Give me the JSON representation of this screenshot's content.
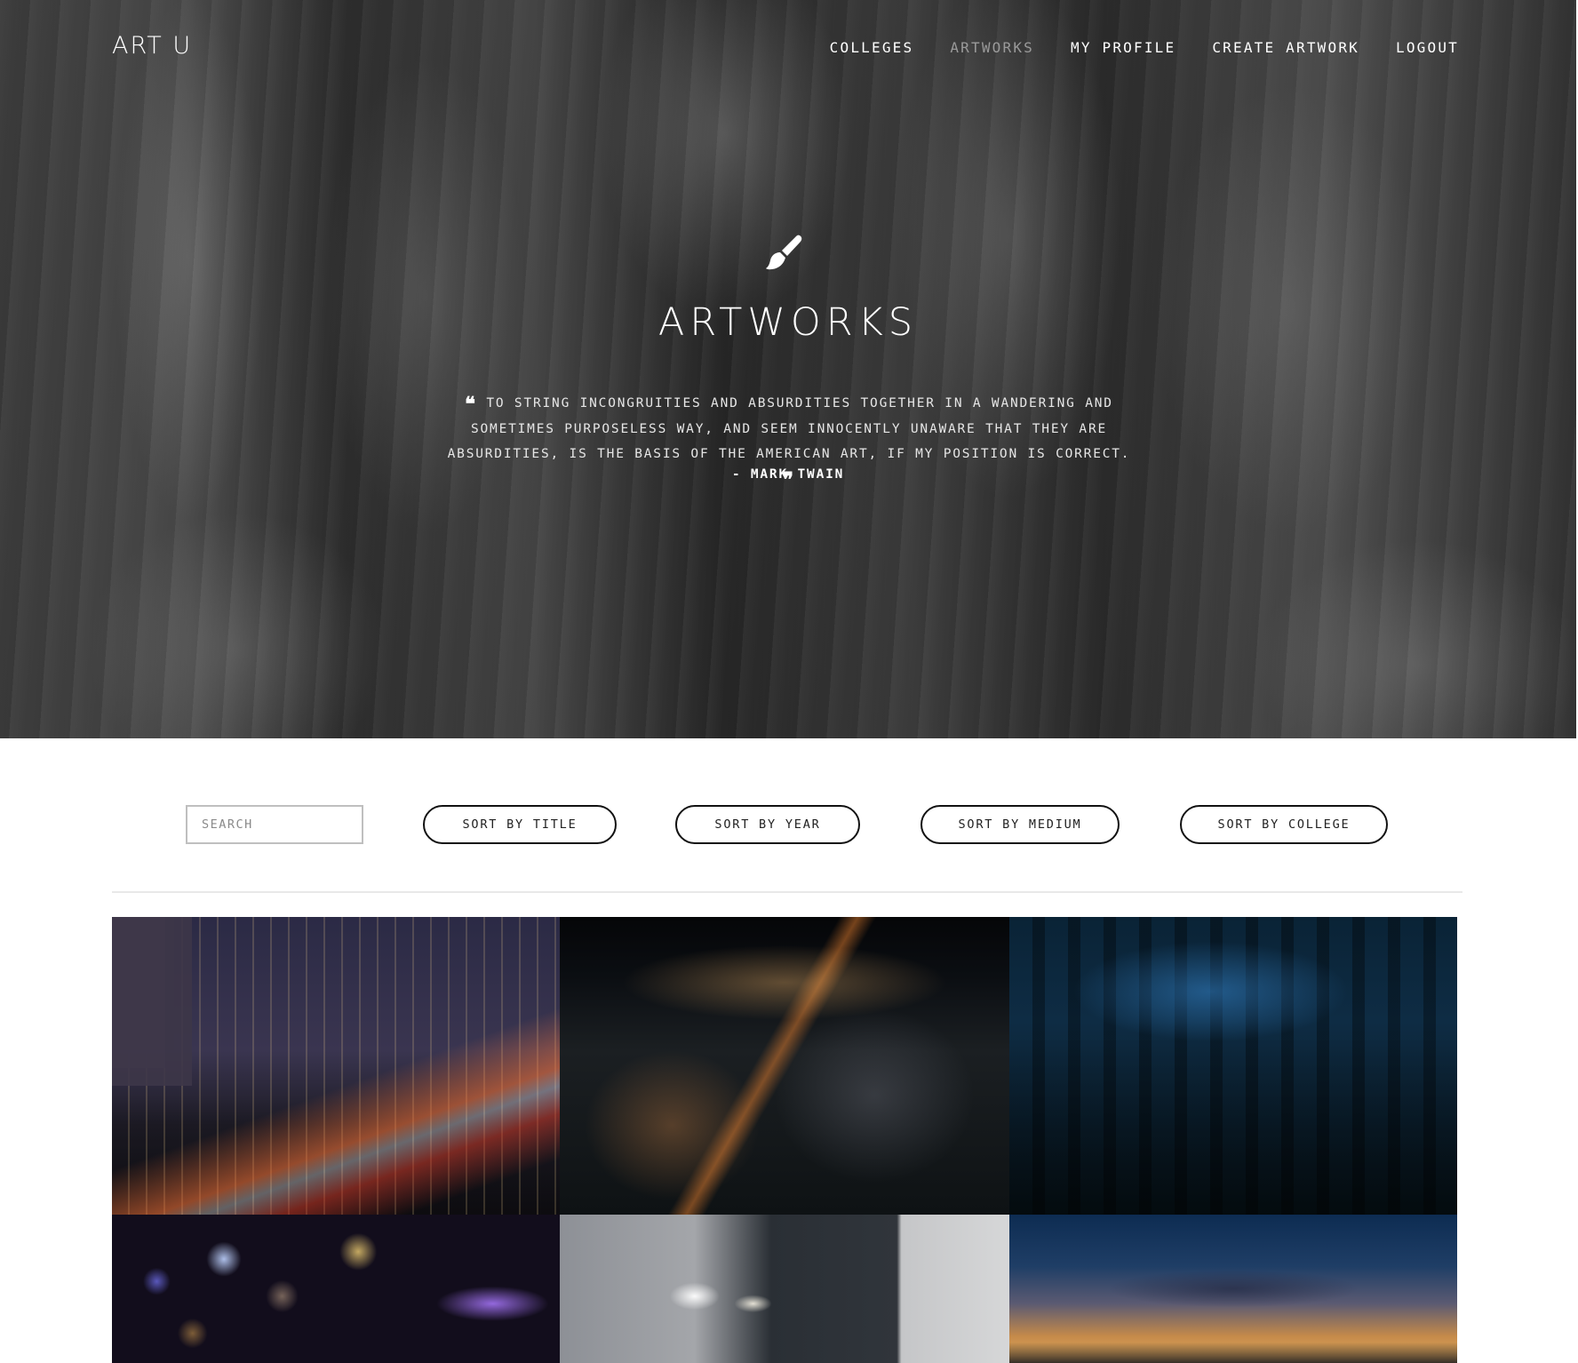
{
  "header": {
    "logo": "ART U",
    "nav": [
      {
        "label": "COLLEGES",
        "active": false
      },
      {
        "label": "ARTWORKS",
        "active": true
      },
      {
        "label": "MY PROFILE",
        "active": false
      },
      {
        "label": "CREATE ARTWORK",
        "active": false
      },
      {
        "label": "LOGOUT",
        "active": false
      }
    ]
  },
  "hero": {
    "icon": "paintbrush-icon",
    "title": "ARTWORKS",
    "quote": "TO STRING INCONGRUITIES AND ABSURDITIES TOGETHER IN A WANDERING AND SOMETIMES PURPOSELESS WAY, AND SEEM INNOCENTLY UNAWARE THAT THEY ARE ABSURDITIES, IS THE BASIS OF THE AMERICAN ART, IF MY POSITION IS CORRECT.",
    "author": "- MARK TWAIN"
  },
  "controls": {
    "search_placeholder": "SEARCH",
    "search_value": "",
    "sort_buttons": [
      "SORT BY TITLE",
      "SORT BY YEAR",
      "SORT BY MEDIUM",
      "SORT BY COLLEGE"
    ]
  },
  "colors": {
    "accent_text": "#ffffff",
    "nav_active": "#9a9a9a",
    "button_border": "#111111"
  }
}
